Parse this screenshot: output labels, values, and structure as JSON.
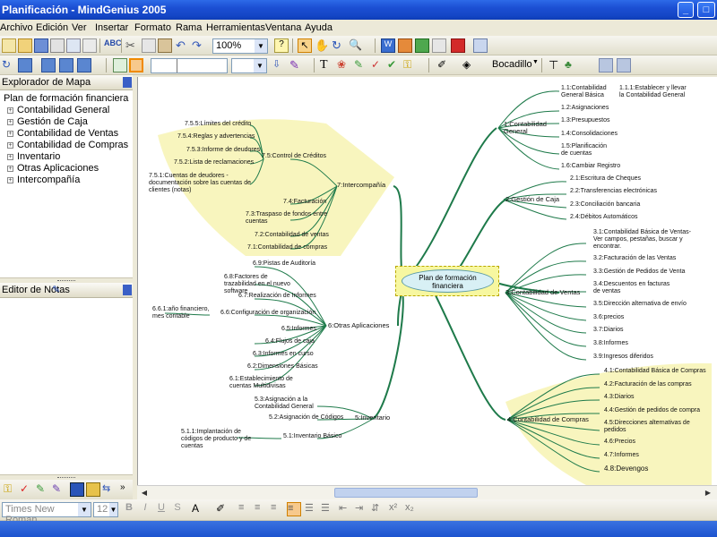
{
  "window": {
    "title": "Planificación - MindGenius 2005"
  },
  "menu": [
    "Archivo",
    "Edición",
    "Ver",
    "Insertar",
    "Formato",
    "Rama",
    "Herramientas",
    "Ventana",
    "Ayuda"
  ],
  "toolbar": {
    "zoom": "100%",
    "style_combo": "Bocadillo",
    "font_combo": "Times New Roman",
    "font_size": "12"
  },
  "explorer": {
    "title": "Explorador de Mapa",
    "root": "Plan de formación financiera",
    "items": [
      "Contabilidad General",
      "Gestión de Caja",
      "Contabilidad de Ventas",
      "Contabilidad de Compras",
      "Inventario",
      "Otras Aplicaciones",
      "Intercompañía"
    ]
  },
  "notes": {
    "title": "Editor de Notas"
  },
  "map": {
    "root": "Plan de formación financiera",
    "branches": {
      "cg": "1:Contabilidad General",
      "cg_items": [
        "1.1:Contabilidad General Básica",
        "1.1.1:Establecer y llevar la Contabilidad General",
        "1.2:Asignaciones",
        "1.3:Presupuestos",
        "1.4:Consolidaciones",
        "1.5:Planificación de cuentas",
        "1.6:Cambiar Registro"
      ],
      "gc": "2:Gestión de Caja",
      "gc_items": [
        "2.1:Escritura de Cheques",
        "2.2:Transferencias electrónicas",
        "2.3:Conciliación bancaria",
        "2.4:Débitos Automáticos"
      ],
      "cv": "3:Contabilidad de Ventas",
      "cv_items": [
        "3.1:Contabilidad Básica de Ventas- Ver campos, pestañas, buscar y encontrar.",
        "3.2:Facturación de las Ventas",
        "3.3:Gestión de Pedidos de Venta",
        "3.4:Descuentos en facturas de ventas",
        "3.5:Dirección alternativa de envío",
        "3.6:precios",
        "3.7:Diarios",
        "3.8:Informes",
        "3.9:Ingresos diferidos"
      ],
      "cc": "4:Contabilidad de Compras",
      "cc_items": [
        "4.1:Contabilidad Básica de Compras",
        "4.2:Facturación de las compras",
        "4.3:Diarios",
        "4.4:Gestión de pedidos de compra",
        "4.5:Direcciones alternativas de pedidos",
        "4.6:Precios",
        "4.7:Informes",
        "4.8:Devengos"
      ],
      "inv": "5:Inventario",
      "inv_items": [
        "5.3:Asignación a la Contabilidad General",
        "5.2:Asignación de Códigos",
        "5.1:Inventario Básico",
        "5.1.1:Implantación de códigos de producto y de cuentas"
      ],
      "oa": "6:Otras Aplicaciones",
      "oa_items": [
        "6.9:Pistas de Auditoría",
        "6.8:Factores de trazabilidad en el nuevo software",
        "6.7:Realización de Informes",
        "6.6:Configuración de organización",
        "6.6.1:año financiero, mes contable",
        "6.5:Informes",
        "6.4:Flujos de caja",
        "6.3:Informes en curso",
        "6.2:Dimensiones Básicas",
        "6.1:Establecimiento de cuentas Multidivisas"
      ],
      "ic": "7:Intercompañía",
      "ic_items": [
        "7.5:Control de Créditos",
        "7.5.5:Límites del crédito",
        "7.5.4:Reglas y advertencias",
        "7.5.3:Informe de deudores",
        "7.5.2:Lista de reclamaciones",
        "7.5.1:Cuentas de deudores - documentación sobre las cuentas de clientes (notas)",
        "7.4:Facturación",
        "7.3:Traspaso de fondos entre cuentas",
        "7.2:Contabilidad de ventas",
        "7.1:Contabilidad de compras"
      ]
    }
  },
  "colors": {
    "branch": "#1e7a4a",
    "highlight": "#f4f1a6",
    "titlebar": "#1c4fd3"
  }
}
